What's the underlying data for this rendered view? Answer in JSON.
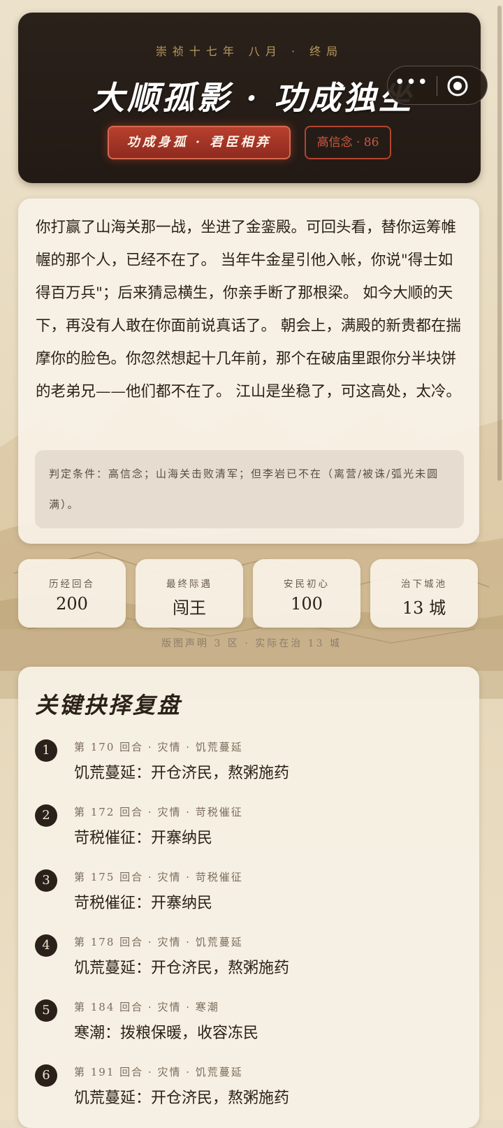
{
  "header": {
    "date": "崇祯十七年 八月 · 终局",
    "title": "大顺孤影 · 功成独坐",
    "ending_badge": "功成身孤 · 君臣相弃",
    "trust_badge": "高信念 · 86"
  },
  "capsule": {
    "more_label": "•••"
  },
  "story": {
    "text": "你打赢了山海关那一战，坐进了金銮殿。可回头看，替你运筹帷幄的那个人，已经不在了。 当年牛金星引他入帐，你说\"得士如得百万兵\"；后来猜忌横生，你亲手断了那根梁。 如今大顺的天下，再没有人敢在你面前说真话了。 朝会上，满殿的新贵都在揣摩你的脸色。你忽然想起十几年前，那个在破庙里跟你分半块饼的老弟兄——他们都不在了。 江山是坐稳了，可这高处，太冷。",
    "condition": "判定条件：高信念；山海关击败清军；但李岩已不在（离营/被诛/弧光未圆满）。"
  },
  "stats": [
    {
      "label": "历经回合",
      "value": "200"
    },
    {
      "label": "最终际遇",
      "value": "闯王"
    },
    {
      "label": "安民初心",
      "value": "100"
    },
    {
      "label": "治下城池",
      "value": "13 城"
    }
  ],
  "stats_note": "版图声明 3 区 · 实际在治 13 城",
  "review": {
    "title": "关键抉择复盘",
    "items": [
      {
        "num": "1",
        "meta": "第 170 回合 · 灾情 · 饥荒蔓延",
        "choice": "饥荒蔓延：开仓济民，熬粥施药"
      },
      {
        "num": "2",
        "meta": "第 172 回合 · 灾情 · 苛税催征",
        "choice": "苛税催征：开寨纳民"
      },
      {
        "num": "3",
        "meta": "第 175 回合 · 灾情 · 苛税催征",
        "choice": "苛税催征：开寨纳民"
      },
      {
        "num": "4",
        "meta": "第 178 回合 · 灾情 · 饥荒蔓延",
        "choice": "饥荒蔓延：开仓济民，熬粥施药"
      },
      {
        "num": "5",
        "meta": "第 184 回合 · 灾情 · 寒潮",
        "choice": "寒潮：拨粮保暖，收容冻民"
      },
      {
        "num": "6",
        "meta": "第 191 回合 · 灾情 · 饥荒蔓延",
        "choice": "饥荒蔓延：开仓济民，熬粥施药"
      }
    ]
  }
}
